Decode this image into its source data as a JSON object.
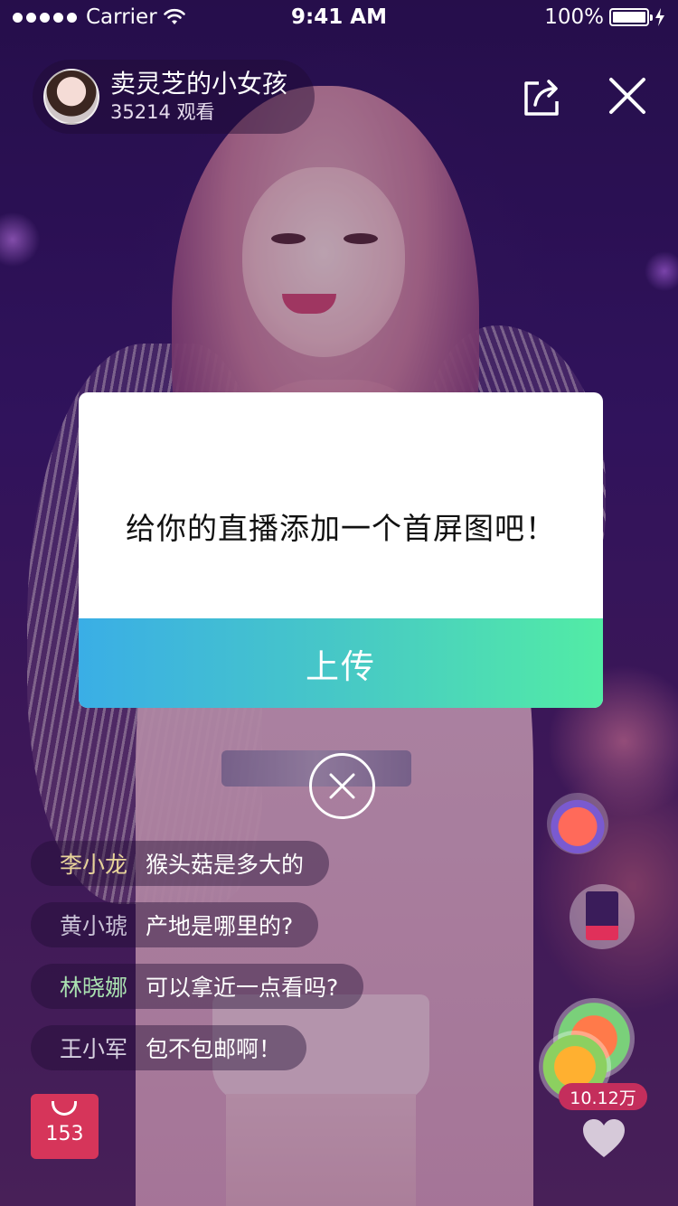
{
  "status_bar": {
    "carrier": "Carrier",
    "time": "9:41 AM",
    "battery": "100%"
  },
  "host": {
    "name": "卖灵芝的小女孩",
    "viewers": "35214 观看"
  },
  "icons": {
    "share": "share-icon",
    "close": "close-icon",
    "dismiss": "close-circle-icon",
    "like": "heart-icon",
    "cart": "shopping-bag-icon"
  },
  "dialog": {
    "message": "给你的直播添加一个首屏图吧！",
    "button": "上传"
  },
  "chat": [
    {
      "user": "李小龙",
      "message": "猴头菇是多大的",
      "user_color": "#e8d49a"
    },
    {
      "user": "黄小琥",
      "message": "产地是哪里的?",
      "user_color": "#c9c2d6"
    },
    {
      "user": "林晓娜",
      "message": "可以拿近一点看吗?",
      "user_color": "#a9e0b0"
    },
    {
      "user": "王小军",
      "message": "包不包邮啊！",
      "user_color": "#d6d0e0"
    }
  ],
  "likes": "10.12万",
  "cart_count": "153",
  "colors": {
    "button_gradient_start": "#3aaee6",
    "button_gradient_end": "#52eca5",
    "likes_badge": "#c42e5c",
    "cart_badge": "#d6355a"
  }
}
